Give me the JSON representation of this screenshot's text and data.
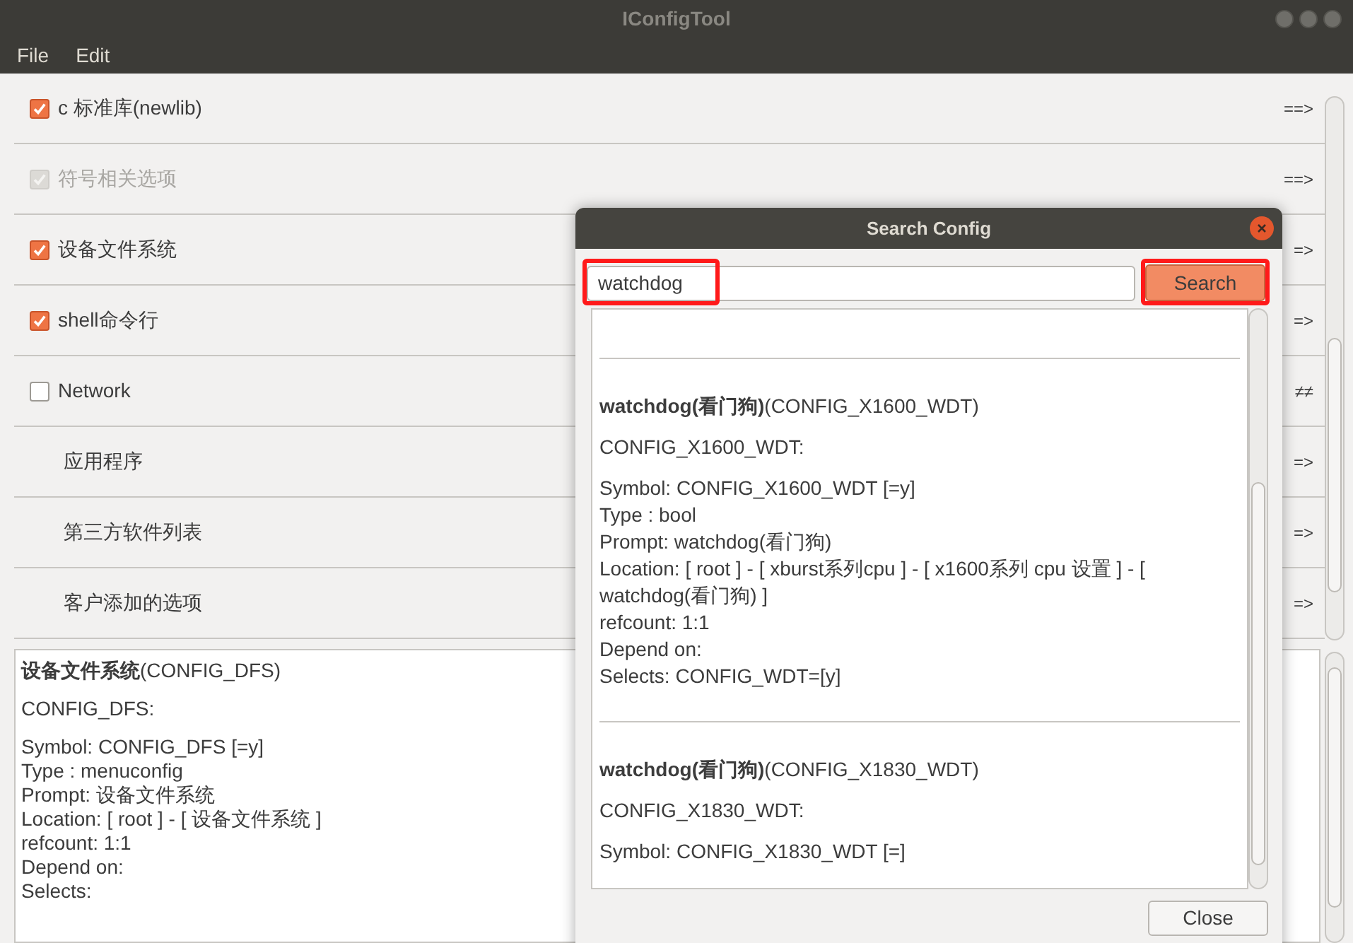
{
  "window": {
    "title": "IConfigTool",
    "menu": [
      "File",
      "Edit"
    ]
  },
  "options": [
    {
      "kind": "checkbox",
      "label": "c 标准库(newlib)",
      "checked": true,
      "disabled": false,
      "arrow": "==>"
    },
    {
      "kind": "checkbox",
      "label": "符号相关选项",
      "checked": true,
      "disabled": true,
      "arrow": "==>"
    },
    {
      "kind": "checkbox",
      "label": "设备文件系统",
      "checked": true,
      "disabled": false,
      "arrow": "=>"
    },
    {
      "kind": "checkbox",
      "label": "shell命令行",
      "checked": true,
      "disabled": false,
      "arrow": "=>"
    },
    {
      "kind": "checkbox",
      "label": "Network",
      "checked": false,
      "disabled": false,
      "arrow": "≠≠"
    },
    {
      "kind": "menu",
      "label": "应用程序",
      "arrow": "=>"
    },
    {
      "kind": "menu",
      "label": "第三方软件列表",
      "arrow": "=>"
    },
    {
      "kind": "menu",
      "label": "客户添加的选项",
      "arrow": "=>"
    }
  ],
  "details": {
    "blocks": [
      [
        "**设备文件系统**(CONFIG_DFS)"
      ],
      [
        "CONFIG_DFS:"
      ],
      [
        "Symbol: CONFIG_DFS [=y]",
        "Type : menuconfig",
        "Prompt: 设备文件系统",
        "Location: [ root ] - [ 设备文件系统 ]",
        "refcount: 1:1",
        "Depend on:",
        "Selects:"
      ]
    ]
  },
  "search_dialog": {
    "title": "Search Config",
    "query": "watchdog",
    "query_highlighted": true,
    "button": "Search",
    "button_highlighted": true,
    "results": [
      {
        "blocks": [
          [
            "**watchdog(看门狗)**(CONFIG_X1600_WDT)"
          ],
          [
            "CONFIG_X1600_WDT:"
          ],
          [
            "Symbol: CONFIG_X1600_WDT [=y]",
            "Type : bool",
            "Prompt: watchdog(看门狗)",
            "Location: [ root ] - [ xburst系列cpu ] - [ x1600系列 cpu 设置 ] - [ watchdog(看门狗) ]",
            "refcount: 1:1",
            "Depend on:",
            "Selects: CONFIG_WDT=[y]"
          ]
        ]
      },
      {
        "blocks": [
          [
            "**watchdog(看门狗)**(CONFIG_X1830_WDT)"
          ],
          [
            "CONFIG_X1830_WDT:"
          ],
          [
            "Symbol: CONFIG_X1830_WDT [=]"
          ]
        ]
      }
    ],
    "close": "Close"
  }
}
